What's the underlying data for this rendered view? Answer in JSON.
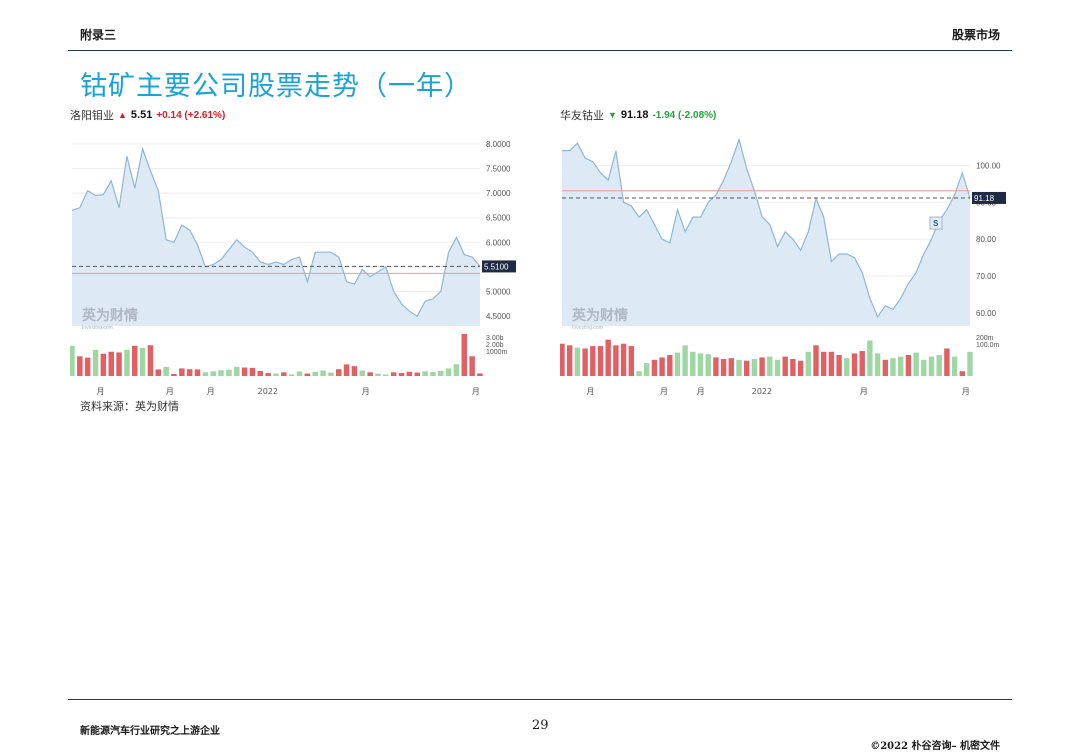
{
  "header": {
    "left": "附录三",
    "right": "股票市场"
  },
  "title": "钴矿主要公司股票走势（一年）",
  "source": "资料来源：英为财情",
  "footer": {
    "left": "新能源汽车行业研究之上游企业",
    "page": "29",
    "right": "©2022 朴谷咨询– 机密文件"
  },
  "colors": {
    "up": "#e0191f",
    "down": "#22a43a",
    "line": "#8fb7d6",
    "area": "#dde9f4",
    "title": "#1aa3d4",
    "vol_up": "#9fd7a4",
    "vol_down": "#e06064"
  },
  "chart_data": [
    {
      "type": "area",
      "name": "洛阳钼业",
      "arrow": "up-triangle",
      "price": "5.51",
      "change": "+0.14 (+2.61%)",
      "watermark": "英为财情",
      "watermark_sub": "Investing.com",
      "ylim": [
        4.3,
        8.2
      ],
      "yticks": [
        "8.0000",
        "7.5000",
        "7.0000",
        "6.5000",
        "6.0000",
        "5.5000",
        "5.0000",
        "4.5000"
      ],
      "current_label": "5.5100",
      "current_value": 5.51,
      "prev_close": 5.37,
      "vol_ticks": [
        "3.00b",
        "2.00b",
        "1000m"
      ],
      "vol_max": 3200,
      "xlabels": [
        "月",
        "月",
        "月",
        "2022",
        "月",
        "月"
      ],
      "xlabel_pos": [
        0.07,
        0.24,
        0.34,
        0.48,
        0.72,
        0.99
      ],
      "values": [
        6.65,
        6.7,
        7.05,
        6.95,
        6.97,
        7.25,
        6.7,
        7.75,
        7.1,
        7.9,
        7.45,
        7.05,
        6.05,
        6.0,
        6.35,
        6.25,
        5.95,
        5.5,
        5.55,
        5.65,
        5.85,
        6.05,
        5.9,
        5.8,
        5.6,
        5.55,
        5.6,
        5.55,
        5.65,
        5.7,
        5.2,
        5.8,
        5.8,
        5.8,
        5.7,
        5.2,
        5.15,
        5.45,
        5.3,
        5.4,
        5.5,
        5.0,
        4.75,
        4.6,
        4.5,
        4.8,
        4.85,
        5.0,
        5.8,
        6.1,
        5.75,
        5.7,
        5.51
      ],
      "volumes": [
        2300,
        1500,
        1400,
        2000,
        1700,
        1850,
        1800,
        2000,
        2300,
        2150,
        2350,
        500,
        700,
        150,
        580,
        520,
        500,
        280,
        360,
        440,
        480,
        700,
        650,
        620,
        380,
        220,
        180,
        280,
        120,
        340,
        190,
        320,
        420,
        260,
        520,
        880,
        750,
        420,
        280,
        180,
        120,
        280,
        220,
        320,
        260,
        360,
        300,
        390,
        580,
        900,
        3200,
        1500,
        200
      ],
      "vol_dir": [
        1,
        -1,
        -1,
        1,
        -1,
        -1,
        -1,
        1,
        -1,
        1,
        -1,
        -1,
        1,
        -1,
        -1,
        -1,
        -1,
        1,
        1,
        1,
        1,
        1,
        -1,
        -1,
        -1,
        -1,
        1,
        -1,
        1,
        1,
        -1,
        1,
        1,
        1,
        -1,
        -1,
        -1,
        1,
        -1,
        1,
        1,
        -1,
        -1,
        -1,
        -1,
        1,
        1,
        1,
        1,
        1,
        -1,
        -1,
        -1
      ]
    },
    {
      "type": "area",
      "name": "华友钴业",
      "arrow": "down-triangle",
      "price": "91.18",
      "change": "-1.94 (-2.08%)",
      "watermark": "英为财情",
      "watermark_sub": "Investing.com",
      "ylim": [
        56.5,
        108.5
      ],
      "yticks": [
        "100.00",
        "90.00",
        "80.00",
        "70.00",
        "60.00"
      ],
      "ytick_values": [
        100,
        90,
        80,
        70,
        60
      ],
      "current_label": "91.18",
      "current_value": 91.18,
      "prev_close": 93.12,
      "event_badge": "S",
      "vol_ticks": [
        "200m",
        "100.0m"
      ],
      "vol_max": 260,
      "xlabels": [
        "月",
        "月",
        "月",
        "2022",
        "月",
        "月"
      ],
      "xlabel_pos": [
        0.07,
        0.25,
        0.34,
        0.49,
        0.74,
        0.99
      ],
      "values": [
        104,
        104,
        106,
        102,
        101,
        98,
        96,
        104,
        90,
        89,
        86,
        88,
        84,
        80,
        79,
        88,
        82,
        86,
        86,
        90,
        92,
        96,
        101,
        107,
        99,
        93,
        86,
        84,
        78,
        82,
        80,
        77,
        82,
        91,
        86,
        74,
        76,
        76,
        75,
        71,
        64,
        59,
        62,
        61,
        64,
        68,
        71,
        76,
        80,
        85,
        88,
        92,
        98,
        91.18
      ],
      "volumes": [
        200,
        190,
        175,
        170,
        185,
        185,
        225,
        190,
        200,
        185,
        30,
        80,
        100,
        115,
        130,
        145,
        190,
        150,
        140,
        135,
        115,
        105,
        110,
        100,
        95,
        105,
        115,
        120,
        100,
        120,
        105,
        95,
        150,
        190,
        150,
        150,
        130,
        110,
        140,
        155,
        220,
        140,
        100,
        110,
        120,
        130,
        145,
        100,
        120,
        130,
        170,
        120,
        30,
        150
      ],
      "vol_dir": [
        -1,
        -1,
        1,
        -1,
        -1,
        -1,
        -1,
        -1,
        -1,
        -1,
        1,
        1,
        -1,
        -1,
        -1,
        1,
        1,
        1,
        1,
        1,
        -1,
        -1,
        -1,
        1,
        -1,
        1,
        -1,
        1,
        1,
        -1,
        -1,
        -1,
        1,
        -1,
        -1,
        -1,
        -1,
        1,
        -1,
        -1,
        1,
        1,
        -1,
        1,
        1,
        -1,
        1,
        1,
        1,
        1,
        -1,
        1,
        -1,
        1
      ]
    }
  ]
}
